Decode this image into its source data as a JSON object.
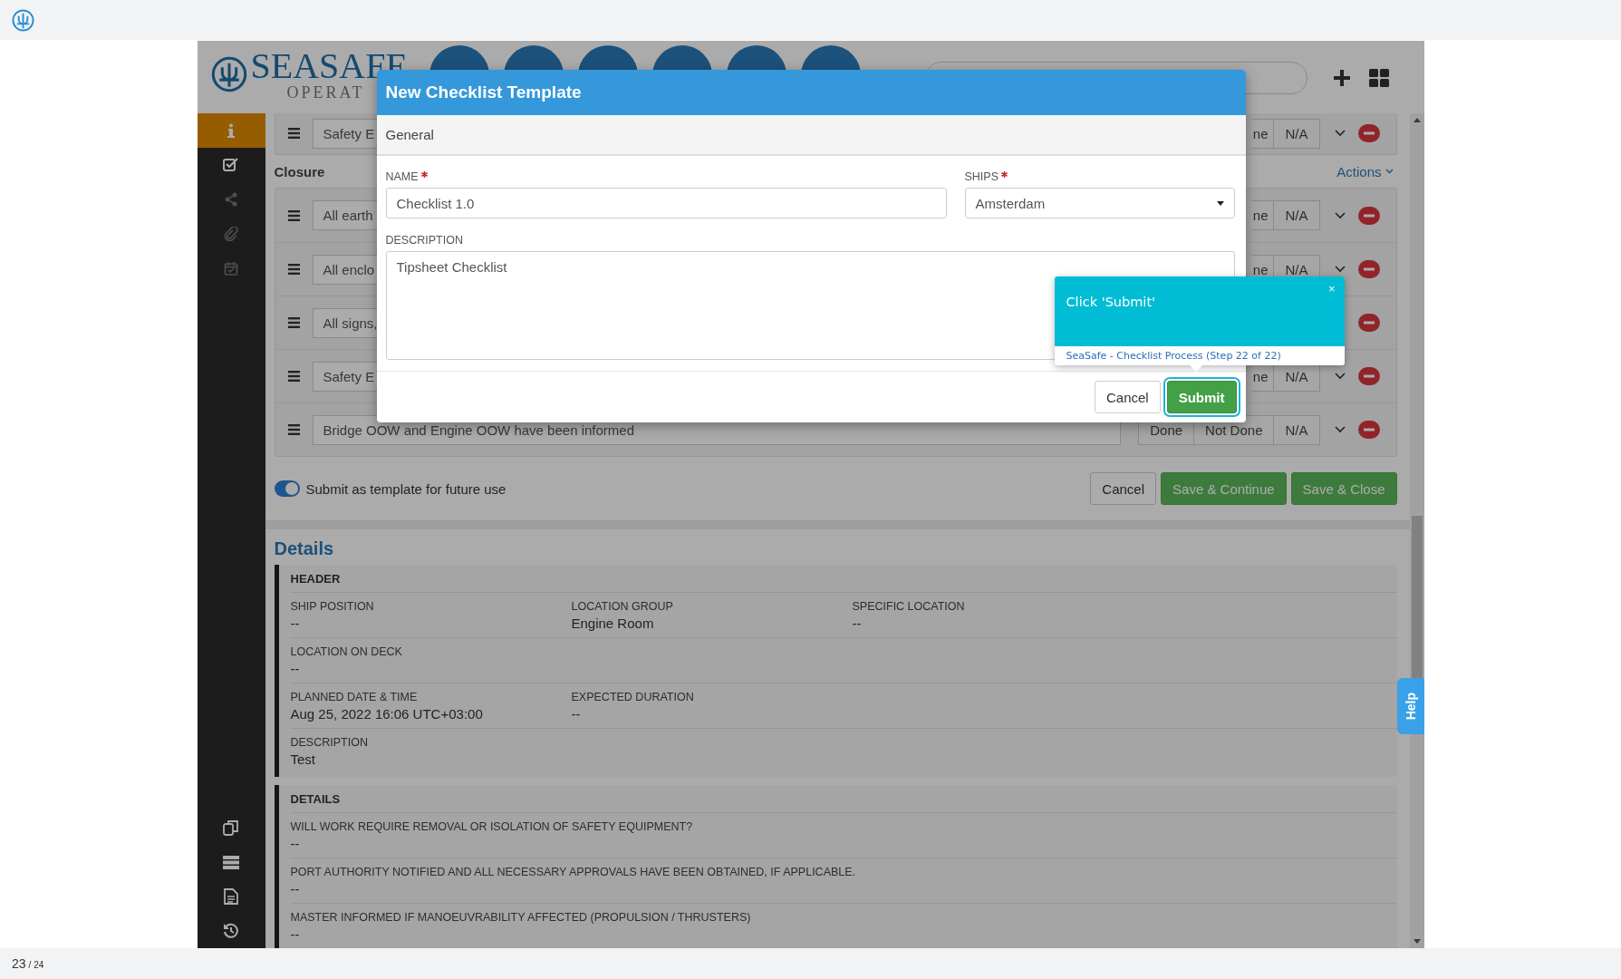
{
  "app": {
    "logo": {
      "name": "SEASAFE",
      "subtitle": "OPERAT"
    },
    "sidebar": {
      "top_items": [
        {
          "kind": "info",
          "selected": true,
          "disabled": false
        },
        {
          "kind": "checklist",
          "selected": false,
          "disabled": false
        },
        {
          "kind": "share",
          "selected": false,
          "disabled": true
        },
        {
          "kind": "attachment",
          "selected": false,
          "disabled": true
        },
        {
          "kind": "calendar",
          "selected": false,
          "disabled": true
        }
      ],
      "bottom_items": [
        {
          "kind": "copy",
          "selected": false,
          "disabled": false
        },
        {
          "kind": "list",
          "selected": false,
          "disabled": false
        },
        {
          "kind": "document",
          "selected": false,
          "disabled": false
        },
        {
          "kind": "history",
          "selected": false,
          "disabled": false
        }
      ]
    },
    "top_rows": [
      {
        "kind": "cut",
        "text": "Safety E",
        "options": [
          "ne",
          "N/A"
        ]
      }
    ],
    "closure": {
      "title": "Closure",
      "actions": "Actions"
    },
    "rows": [
      {
        "kind": "cut",
        "text": "All earth",
        "options": [
          "ne",
          "N/A"
        ]
      },
      {
        "kind": "cut",
        "text": "All enclo",
        "options": [
          "ne",
          "N/A"
        ]
      },
      {
        "kind": "cut",
        "text": "All signs,"
      },
      {
        "kind": "cut",
        "text": "Safety E",
        "options": [
          "ne",
          "N/A"
        ]
      },
      {
        "kind": "full",
        "text": "Bridge OOW and Engine OOW have been informed",
        "options": [
          "Done",
          "Not Done",
          "N/A"
        ]
      }
    ],
    "template_toggle": {
      "label": "Submit as template for future use",
      "on": true
    },
    "form_buttons": [
      {
        "label": "Cancel",
        "kind": "default"
      },
      {
        "label": "Save & Continue",
        "kind": "primary"
      },
      {
        "label": "Save & Close",
        "kind": "primary"
      }
    ],
    "details": {
      "title": "Details",
      "sections": [
        {
          "title": "HEADER",
          "rows": [
            [
              {
                "label": "SHIP POSITION",
                "value": "--"
              },
              {
                "label": "LOCATION GROUP",
                "value": "Engine Room"
              },
              {
                "label": "SPECIFIC LOCATION",
                "value": "--"
              }
            ],
            [
              {
                "label": "LOCATION ON DECK",
                "value": "--"
              }
            ],
            [
              {
                "label": "PLANNED DATE & TIME",
                "value": "Aug 25, 2022 16:06 UTC+03:00"
              },
              {
                "label": "EXPECTED DURATION",
                "value": "--"
              }
            ],
            [
              {
                "label": "DESCRIPTION",
                "value": "Test"
              }
            ]
          ]
        },
        {
          "title": "DETAILS",
          "rows": [
            [
              {
                "label": "WILL WORK REQUIRE REMOVAL OR ISOLATION OF SAFETY EQUIPMENT?",
                "value": "--"
              }
            ],
            [
              {
                "label": "PORT AUTHORITY NOTIFIED AND ALL NECESSARY APPROVALS HAVE BEEN OBTAINED, IF APPLICABLE.",
                "value": "--"
              }
            ],
            [
              {
                "label": "MASTER INFORMED IF MANOEUVRABILITY AFFECTED (PROPULSION / THRUSTERS)",
                "value": "--"
              }
            ]
          ]
        }
      ]
    },
    "help_tab": "Help",
    "modal": {
      "title": "New Checklist Template",
      "section": "General",
      "name_field": {
        "label": "NAME",
        "required": true,
        "value": "Checklist 1.0"
      },
      "ships_field": {
        "label": "SHIPS",
        "required": true,
        "value": "Amsterdam"
      },
      "description_field": {
        "label": "DESCRIPTION",
        "required": false,
        "value": "Tipsheet Checklist"
      },
      "buttons": [
        {
          "label": "Cancel",
          "kind": "default",
          "highlighted": false
        },
        {
          "label": "Submit",
          "kind": "primary",
          "highlighted": true
        }
      ]
    },
    "tour_tooltip": {
      "text": "Click 'Submit'",
      "close": "×",
      "footer": "SeaSafe - Checklist Process (Step 22 of 22)"
    }
  },
  "pager": {
    "current": "23",
    "total": "/ 24"
  }
}
